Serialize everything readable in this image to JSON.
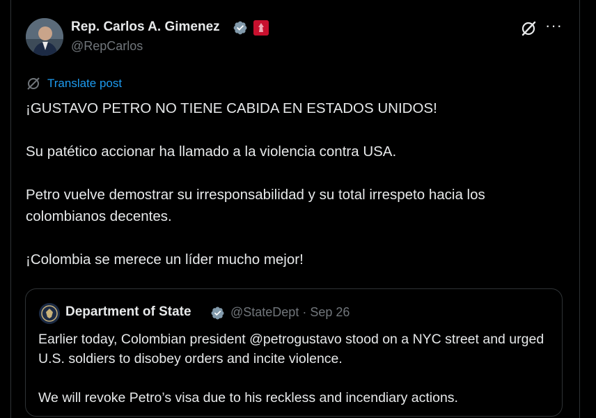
{
  "post": {
    "author_name": "Rep. Carlos A. Gimenez",
    "handle": "@RepCarlos",
    "translate_label": "Translate post",
    "paragraphs": [
      "¡GUSTAVO PETRO NO TIENE CABIDA EN ESTADOS UNIDOS!",
      "Su patético accionar ha llamado a la violencia contra USA.",
      "Petro vuelve demostrar su irresponsabilidad y su total irrespeto hacia los colombianos decentes.",
      "¡Colombia se merece un líder mucho mejor!"
    ]
  },
  "quoted": {
    "author_name": "Department of State",
    "handle": "@StateDept",
    "separator": "·",
    "date": "Sep 26",
    "paragraphs": [
      "Earlier today, Colombian president @petrogustavo stood on a NYC street and urged U.S. soldiers to disobey orders and incite violence.",
      "We will revoke Petro’s visa due to his reckless and incendiary actions."
    ]
  },
  "icons": {
    "verified": "verified-badge-icon",
    "affiliation": "house-seal-icon",
    "grok": "grok-icon",
    "more": "more-icon",
    "translate": "globe-icon"
  },
  "colors": {
    "background": "#000000",
    "text": "#e7e9ea",
    "muted": "#71767b",
    "link": "#1d9bf0",
    "verified": "#829aab",
    "border": "#2f3336",
    "affiliation": "#c8102e"
  }
}
